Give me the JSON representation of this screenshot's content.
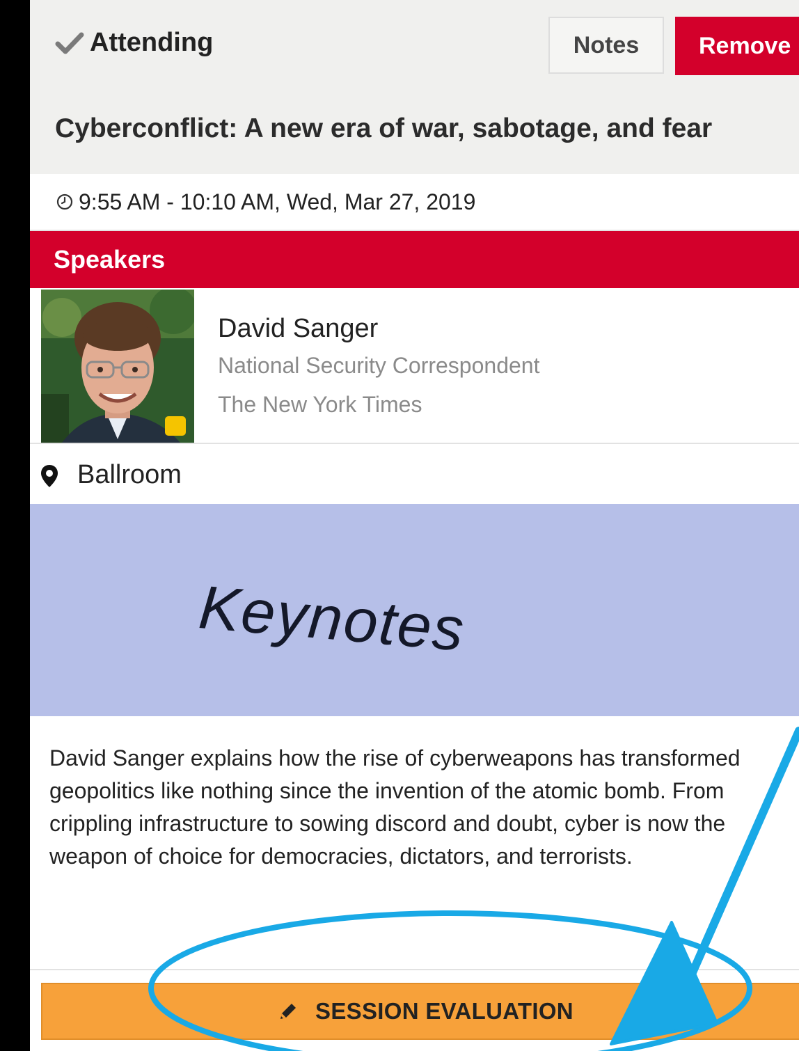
{
  "header": {
    "attending_label": "Attending",
    "notes_label": "Notes",
    "remove_label": "Remove"
  },
  "session": {
    "title": "Cyberconflict: A new era of war, sabotage, and fear",
    "time": "9:55 AM - 10:10 AM, Wed, Mar 27, 2019",
    "location": "Ballroom",
    "banner_text": "Keynotes",
    "description": "David Sanger explains how the rise of cyberweapons has transformed geopolitics like nothing since the invention of the atomic bomb. From crippling infrastructure to sowing discord and doubt, cyber is now the weapon of choice for democracies, dictators, and terrorists."
  },
  "speakers": {
    "section_label": "Speakers",
    "items": [
      {
        "name": "David Sanger",
        "title": "National Security Correspondent",
        "organization": "The New York Times"
      }
    ]
  },
  "evaluation": {
    "label": "SESSION EVALUATION"
  },
  "colors": {
    "accent_red": "#d3002b",
    "evaluation_orange": "#f7a13a",
    "banner_blue": "#b6bfe8",
    "annotation_blue": "#19a9e6"
  },
  "icons": {
    "attending": "check-icon",
    "time": "clock-icon",
    "location": "map-pin-icon",
    "evaluation": "pencil-icon"
  }
}
